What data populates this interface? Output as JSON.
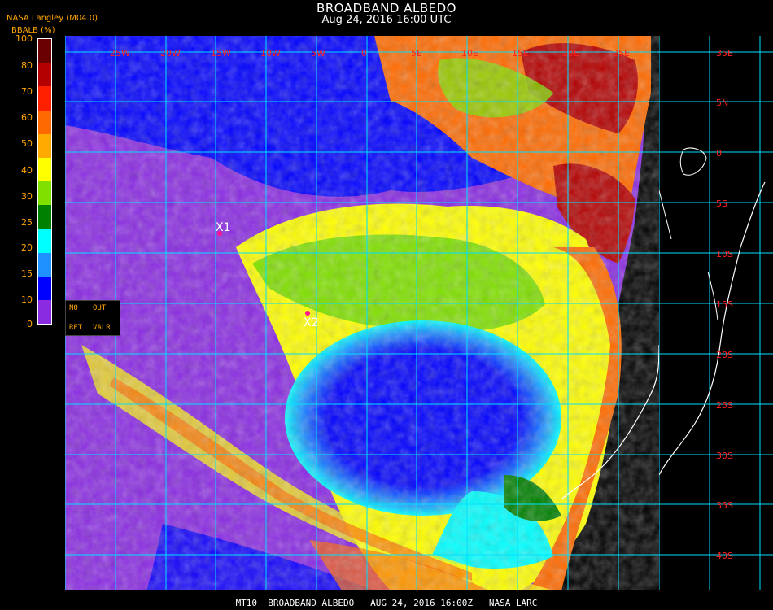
{
  "header": {
    "title": "BROADBAND ALBEDO",
    "subtitle": "Aug 24, 2016 16:00 UTC",
    "source": "NASA Langley (M04.0)"
  },
  "colorbar": {
    "title": "BBALB (%)",
    "ticks": [
      "100",
      "80",
      "70",
      "60",
      "50",
      "40",
      "30",
      "25",
      "20",
      "15",
      "10",
      "0"
    ],
    "bands": [
      {
        "label": "90-100",
        "color": "#6a0000"
      },
      {
        "label": "80-90",
        "color": "#b40000"
      },
      {
        "label": "70-80",
        "color": "#ff2000"
      },
      {
        "label": "60-70",
        "color": "#ff6a00"
      },
      {
        "label": "50-60",
        "color": "#ffaa00"
      },
      {
        "label": "40-50",
        "color": "#ffff00"
      },
      {
        "label": "30-40",
        "color": "#80e000"
      },
      {
        "label": "25-30",
        "color": "#008000"
      },
      {
        "label": "20-25",
        "color": "#00ffff"
      },
      {
        "label": "15-20",
        "color": "#1e90ff"
      },
      {
        "label": "10-15",
        "color": "#0000ff"
      },
      {
        "label": "0-10",
        "color": "#8a2be2"
      }
    ]
  },
  "legend": {
    "no_ret": [
      "NO",
      "RET"
    ],
    "out_valr": [
      "OUT",
      "VALR"
    ]
  },
  "grid": {
    "lon_labels": [
      "25W",
      "20W",
      "15W",
      "10W",
      "5W",
      "0",
      "5E",
      "10E",
      "15E",
      "20E",
      "25E",
      "30E"
    ],
    "lat_labels": [
      "35E",
      "5N",
      "0",
      "5S",
      "10S",
      "15S",
      "20S",
      "25S",
      "30S",
      "35S",
      "40S"
    ]
  },
  "markers": [
    {
      "name": "X1",
      "label": "X1"
    },
    {
      "name": "X2",
      "label": "X2"
    }
  ],
  "footer": "MT10  BROADBAND ALBEDO   AUG 24, 2016 16:00Z   NASA LARC"
}
